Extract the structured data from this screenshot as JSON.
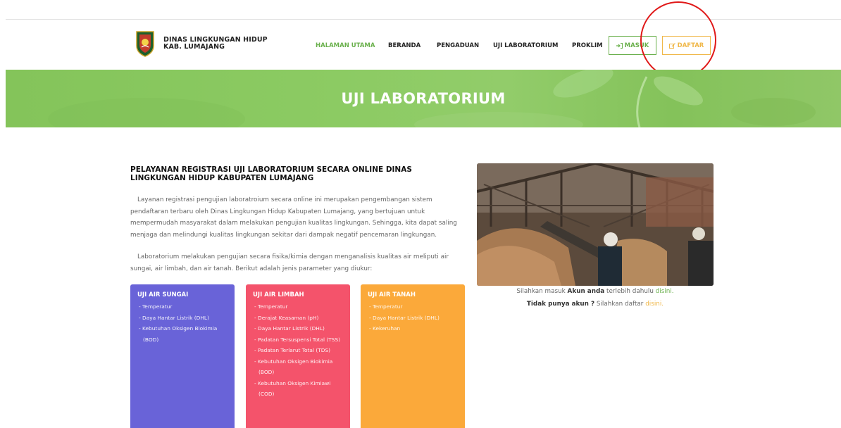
{
  "brand": {
    "line1": "DINAS LINGKUNGAN HIDUP",
    "line2": "KAB. LUMAJANG",
    "logo_icon": "regency-crest-icon"
  },
  "nav": {
    "items": [
      {
        "label": "HALAMAN UTAMA",
        "active": true
      },
      {
        "label": "BERANDA",
        "active": false
      },
      {
        "label": "PENGADUAN",
        "active": false
      },
      {
        "label": "UJI LABORATORIUM",
        "active": false
      },
      {
        "label": "PROKLIM",
        "active": false
      }
    ],
    "login_label": "MASUK",
    "login_icon": "sign-in-icon",
    "register_label": "DAFTAR",
    "register_icon": "edit-icon"
  },
  "banner": {
    "title": "UJI LABORATORIUM"
  },
  "content": {
    "title": "PELAYANAN REGISTRASI UJI LABORATORIUM SECARA ONLINE DINAS LINGKUNGAN HIDUP KABUPATEN LUMAJANG",
    "paragraph1": "Layanan registrasi pengujian laboratroium secara online ini merupakan pengembangan sistem pendaftaran terbaru oleh Dinas Lingkungan Hidup Kabupaten Lumajang, yang bertujuan untuk mempermudah masyarakat dalam melakukan pengujian kualitas lingkungan. Sehingga, kita dapat saling menjaga dan melindungi kualitas lingkungan sekitar dari dampak negatif pencemaran lingkungan.",
    "paragraph2": "Laboratorium melakukan pengujian secara fisika/kimia dengan menganalisis kualitas air meliputi air sungai, air limbah, dan air tanah. Berikut adalah jenis parameter yang diukur:"
  },
  "cards": [
    {
      "title": "UJI AIR SUNGAI",
      "items": [
        "Temperatur",
        "Daya Hantar Listrik (DHL)",
        "Kebutuhan Oksigen Biokimia (BOD)"
      ]
    },
    {
      "title": "UJI AIR LIMBAH",
      "items": [
        "Temperatur",
        "Derajat Keasaman (pH)",
        "Daya Hantar Listrik (DHL)",
        "Padatan Tersuspensi Total (TSS)",
        "Padatan Terlarut Total (TDS)",
        "Kebutuhan Oksigen Biokimia (BOD)",
        "Kebutuhan Oksigen Kimiawi (COD)"
      ]
    },
    {
      "title": "UJI AIR TANAH",
      "items": [
        "Temperatur",
        "Daya Hantar Listrik (DHL)",
        "Kekeruhan"
      ]
    }
  ],
  "login_prompt": {
    "prefix": "Silahkan masuk",
    "bold": "Akun anda",
    "middle": "terlebih dahulu",
    "link": "disini."
  },
  "register_prompt": {
    "bold": "Tidak punya akun ?",
    "middle": "Silahkan daftar",
    "link": "disini."
  },
  "colors": {
    "accent_green": "#6ab04c",
    "accent_yellow": "#f0b84a",
    "card_sungai": "#6963d8",
    "card_limbah": "#f4536b",
    "card_tanah": "#fba93a",
    "annotation": "#e01818"
  }
}
